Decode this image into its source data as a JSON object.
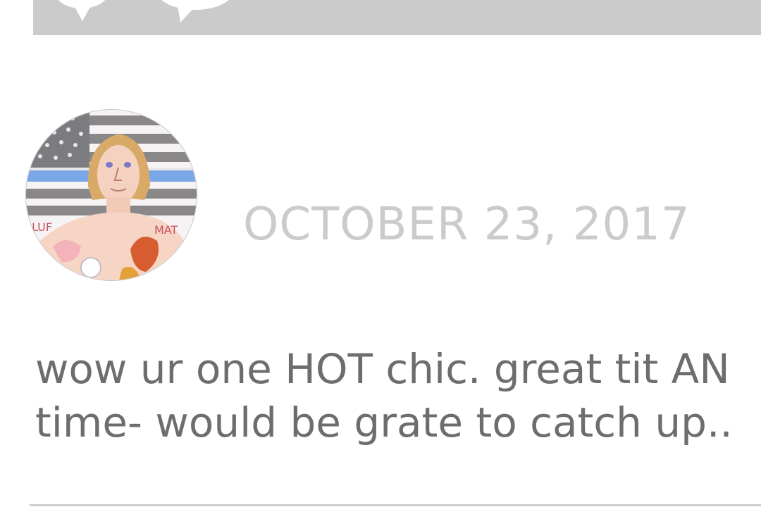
{
  "header": {
    "icons": [
      "speech-bubble-icon",
      "speech-bubble-icon"
    ]
  },
  "comment": {
    "avatar_icon": "user-avatar-illustration",
    "date": "OCTOBER 23, 2017",
    "text_lines": [
      "wow ur one HOT chic. great tit AN",
      "time- would be grate to catch up.."
    ]
  },
  "colors": {
    "top_bar": "#cccbcc",
    "date_text": "#cbcbcb",
    "comment_text": "#6d6d6d",
    "divider": "#cfcfcf",
    "flag_blue_line": "#7aa7e6"
  }
}
